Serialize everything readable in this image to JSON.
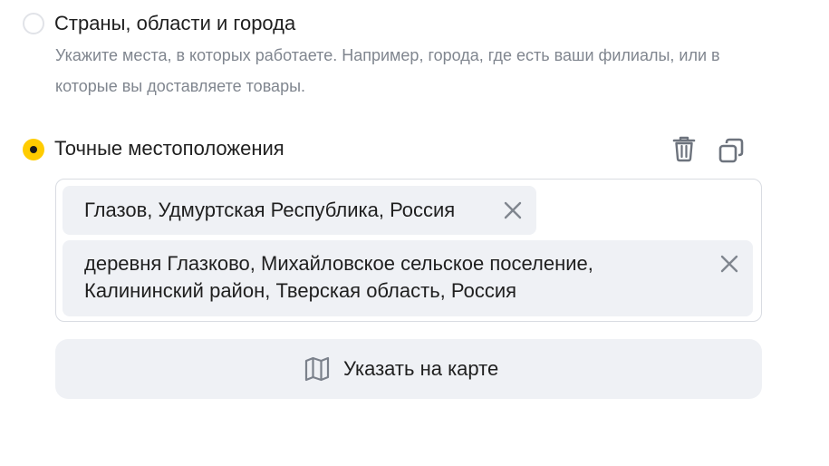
{
  "options": {
    "regions": {
      "title": "Страны, области и города",
      "hint": "Укажите места, в которых работаете. Например, города, где есть ваши филиалы, или в которые вы доставляете товары.",
      "selected": false
    },
    "exact": {
      "title": "Точные местоположения",
      "selected": true
    }
  },
  "actions": {
    "delete_icon": "trash-icon",
    "copy_icon": "copy-icon"
  },
  "locations": [
    {
      "label": "Глазов, Удмуртская Республика, Россия",
      "remove_icon": "close-icon"
    },
    {
      "label": "деревня Глазково, Михайловское сельское поселение, Калининский район, Тверская область, Россия",
      "remove_icon": "close-icon"
    }
  ],
  "map_button": {
    "label": "Указать на карте",
    "icon": "map-icon"
  },
  "colors": {
    "accent": "#ffcc00",
    "chip_bg": "#eff1f5",
    "hint_text": "#80868f",
    "border": "#d9dce2"
  }
}
